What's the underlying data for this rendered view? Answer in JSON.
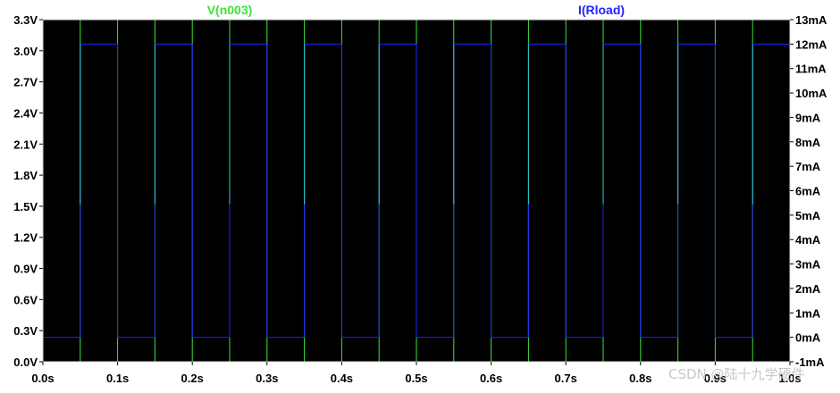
{
  "colors": {
    "background": "#ffffff",
    "plot_bg": "#000000",
    "frame": "#d8d8d8",
    "tick_text": "#000000",
    "voltage_trace": "#39e639",
    "current_trace": "#2323ff",
    "transition_trace": "#2bd0c0"
  },
  "watermark": "CSDN @陆十九学硬件",
  "chart_data": {
    "type": "line",
    "title": "",
    "grid": false,
    "x": {
      "label": "",
      "range": [
        0,
        1.0
      ],
      "ticks": [
        0,
        0.1,
        0.2,
        0.3,
        0.4,
        0.5,
        0.6,
        0.7,
        0.8,
        0.9,
        1.0
      ],
      "tick_labels": [
        "0.0s",
        "0.1s",
        "0.2s",
        "0.3s",
        "0.4s",
        "0.5s",
        "0.6s",
        "0.7s",
        "0.8s",
        "0.9s",
        "1.0s"
      ]
    },
    "y_left": {
      "label": "",
      "range": [
        0,
        3.3
      ],
      "ticks": [
        0,
        0.3,
        0.6,
        0.9,
        1.2,
        1.5,
        1.8,
        2.1,
        2.4,
        2.7,
        3.0,
        3.3
      ],
      "tick_labels": [
        "0.0V",
        "0.3V",
        "0.6V",
        "0.9V",
        "1.2V",
        "1.5V",
        "1.8V",
        "2.1V",
        "2.4V",
        "2.7V",
        "3.0V",
        "3.3V"
      ]
    },
    "y_right": {
      "label": "",
      "range": [
        -1,
        13
      ],
      "ticks": [
        -1,
        0,
        1,
        2,
        3,
        4,
        5,
        6,
        7,
        8,
        9,
        10,
        11,
        12,
        13
      ],
      "tick_labels": [
        "-1mA",
        "0mA",
        "1mA",
        "2mA",
        "3mA",
        "4mA",
        "5mA",
        "6mA",
        "7mA",
        "8mA",
        "9mA",
        "10mA",
        "11mA",
        "12mA",
        "13mA"
      ]
    },
    "series": [
      {
        "name": "V(n003)",
        "axis": "left",
        "color": "#39e639",
        "x": [
          0,
          0.05,
          0.05,
          0.1,
          0.1,
          0.15,
          0.15,
          0.2,
          0.2,
          0.25,
          0.25,
          0.3,
          0.3,
          0.35,
          0.35,
          0.4,
          0.4,
          0.45,
          0.45,
          0.5,
          0.5,
          0.55,
          0.55,
          0.6,
          0.6,
          0.65,
          0.65,
          0.7,
          0.7,
          0.75,
          0.75,
          0.8,
          0.8,
          0.85,
          0.85,
          0.9,
          0.9,
          0.95,
          0.95,
          1.0
        ],
        "values": [
          0,
          0,
          3.3,
          3.3,
          0,
          0,
          3.3,
          3.3,
          0,
          0,
          3.3,
          3.3,
          0,
          0,
          3.3,
          3.3,
          0,
          0,
          3.3,
          3.3,
          0,
          0,
          3.3,
          3.3,
          0,
          0,
          3.3,
          3.3,
          0,
          0,
          3.3,
          3.3,
          0,
          0,
          3.3,
          3.3,
          0,
          0,
          3.3,
          3.3
        ]
      },
      {
        "name": "I(Rload)",
        "axis": "right",
        "color": "#2323ff",
        "x": [
          0,
          0.05,
          0.05,
          0.1,
          0.1,
          0.15,
          0.15,
          0.2,
          0.2,
          0.25,
          0.25,
          0.3,
          0.3,
          0.35,
          0.35,
          0.4,
          0.4,
          0.45,
          0.45,
          0.5,
          0.5,
          0.55,
          0.55,
          0.6,
          0.6,
          0.65,
          0.65,
          0.7,
          0.7,
          0.75,
          0.75,
          0.8,
          0.8,
          0.85,
          0.85,
          0.9,
          0.9,
          0.95,
          0.95,
          1.0
        ],
        "values": [
          0,
          0,
          12,
          12,
          0,
          0,
          12,
          12,
          0,
          0,
          12,
          12,
          0,
          0,
          12,
          12,
          0,
          0,
          12,
          12,
          0,
          0,
          12,
          12,
          0,
          0,
          12,
          12,
          0,
          0,
          12,
          12,
          0,
          0,
          12,
          12,
          0,
          0,
          12,
          12
        ]
      }
    ]
  }
}
